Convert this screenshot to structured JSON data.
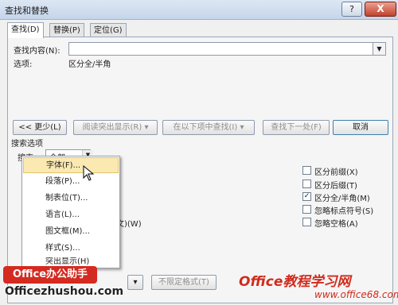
{
  "window": {
    "title": "查找和替换",
    "help": "?",
    "close": "X"
  },
  "tabs": [
    {
      "label": "查找(D)",
      "active": true
    },
    {
      "label": "替换(P)",
      "active": false
    },
    {
      "label": "定位(G)",
      "active": false
    }
  ],
  "find": {
    "label": "查找内容(N):",
    "value": "",
    "options_label": "选项:",
    "options_value": "区分全/半角"
  },
  "buttons": {
    "less": "<< 更少(L)",
    "reading_highlight": "阅读突出显示(R) ▾",
    "find_in": "在以下项中查找(I) ▾",
    "find_next": "查找下一处(F)",
    "cancel": "取消",
    "format_arrow": "▾",
    "no_format": "不限定格式(T)"
  },
  "search_options": {
    "heading": "搜索选项",
    "search_label": "搜索:",
    "search_value": "全部",
    "partial_text": "文)(W)"
  },
  "right_options": [
    {
      "label": "区分前缀(X)",
      "checked": false
    },
    {
      "label": "区分后缀(T)",
      "checked": false
    },
    {
      "label": "区分全/半角(M)",
      "checked": true
    },
    {
      "label": "忽略标点符号(S)",
      "checked": false
    },
    {
      "label": "忽略空格(A)",
      "checked": false
    }
  ],
  "format_menu": [
    {
      "label": "字体(F)...",
      "highlighted": true
    },
    {
      "label": "段落(P)...",
      "highlighted": false
    },
    {
      "label": "制表位(T)...",
      "highlighted": false
    },
    {
      "label": "语言(L)...",
      "highlighted": false
    },
    {
      "label": "图文框(M)...",
      "highlighted": false
    },
    {
      "label": "样式(S)...",
      "highlighted": false
    },
    {
      "label": "突出显示(H)",
      "highlighted": false
    }
  ],
  "watermarks": {
    "office_helper": "Office办公助手",
    "zhushou_url": "Officezhushou.com",
    "brand": "Office教程学习网",
    "site": "www.office68.com"
  },
  "colors": {
    "menu_highlight": "#fbe9b2",
    "watermark_red": "#d42a20"
  }
}
